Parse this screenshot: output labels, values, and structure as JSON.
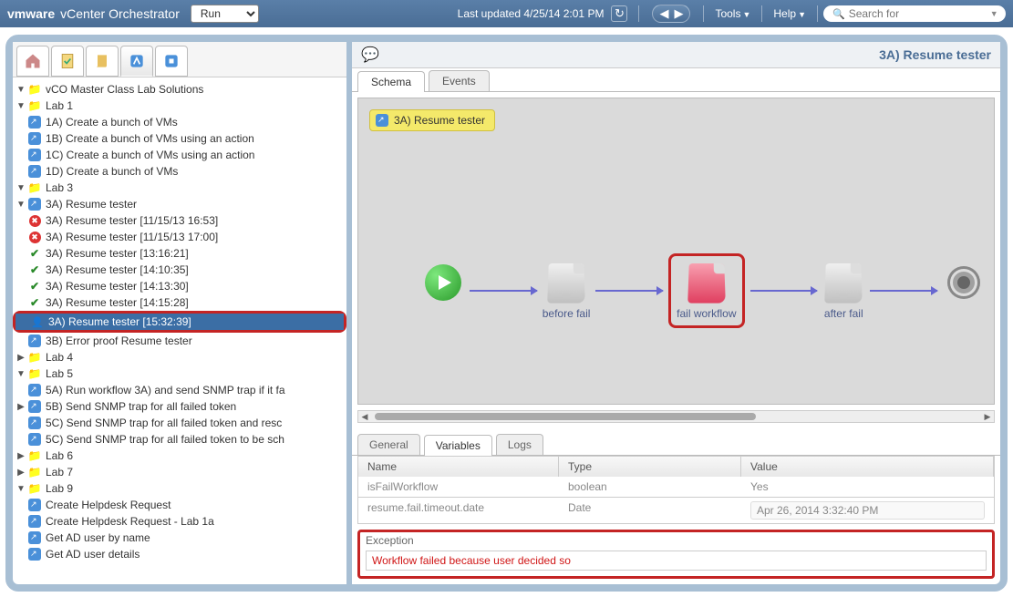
{
  "header": {
    "logo": "vmware",
    "app_name": "vCenter Orchestrator",
    "mode_selected": "Run",
    "last_updated": "Last updated 4/25/14 2:01 PM",
    "tools_label": "Tools",
    "help_label": "Help",
    "search_placeholder": "Search for"
  },
  "tree": {
    "root": "vCO Master Class Lab Solutions",
    "lab1": {
      "label": "Lab 1",
      "items": [
        "1A) Create a bunch of VMs",
        "1B) Create a bunch of VMs using an action",
        "1C) Create a bunch of VMs using an action",
        "1D) Create a bunch of VMs"
      ]
    },
    "lab3": {
      "label": "Lab 3",
      "wf3a_label": "3A) Resume tester",
      "runs_err": [
        "3A) Resume tester [11/15/13  16:53]",
        "3A) Resume tester [11/15/13  17:00]"
      ],
      "runs_ok": [
        "3A) Resume tester [13:16:21]",
        "3A) Resume tester [14:10:35]",
        "3A) Resume tester [14:13:30]",
        "3A) Resume tester [14:15:28]"
      ],
      "run_selected": "3A) Resume tester [15:32:39]",
      "wf3b_label": "3B) Error proof Resume tester"
    },
    "lab4": {
      "label": "Lab 4"
    },
    "lab5": {
      "label": "Lab 5",
      "items": [
        "5A) Run workflow 3A) and send SNMP trap if it fa",
        "5B) Send SNMP trap for all failed token",
        "5C) Send SNMP trap for all failed token and resc",
        "5C) Send SNMP trap for all failed token to be sch"
      ]
    },
    "lab6": {
      "label": "Lab 6"
    },
    "lab7": {
      "label": "Lab 7"
    },
    "lab9": {
      "label": "Lab 9",
      "items": [
        "Create Helpdesk Request",
        "Create Helpdesk Request - Lab 1a",
        "Get AD user by name",
        "Get AD user details"
      ]
    }
  },
  "right": {
    "title": "3A) Resume tester",
    "tabs": {
      "schema": "Schema",
      "events": "Events"
    },
    "wf_badge": "3A) Resume tester",
    "nodes": {
      "before": "before fail",
      "fail": "fail workflow",
      "after": "after fail"
    },
    "sub_tabs": {
      "general": "General",
      "variables": "Variables",
      "logs": "Logs"
    },
    "var_headers": {
      "name": "Name",
      "type": "Type",
      "value": "Value"
    },
    "vars": [
      {
        "name": "isFailWorkflow",
        "type": "boolean",
        "value": "Yes"
      },
      {
        "name": "resume.fail.timeout.date",
        "type": "Date",
        "value": "Apr 26, 2014 3:32:40 PM"
      }
    ],
    "exception": {
      "label": "Exception",
      "message": "Workflow failed because user decided so"
    }
  }
}
